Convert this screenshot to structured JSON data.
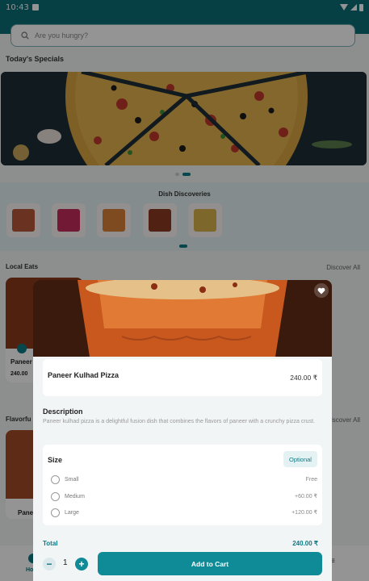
{
  "status": {
    "time": "10:43"
  },
  "search": {
    "placeholder": "Are you hungry?"
  },
  "sections": {
    "specials_title": "Today's Specials",
    "discoveries_title": "Dish Discoveries",
    "local_eats_title": "Local Eats",
    "local_eats_link": "Discover All",
    "flavorful_title": "Flavorfu",
    "flavorful_link": "Discover All"
  },
  "background_cards": {
    "card1_name": "Paneer",
    "card1_price": "240.00",
    "card2_name": "Pane"
  },
  "bottom_nav": {
    "home_label": "Ho"
  },
  "dish": {
    "name": "Paneer Kulhad Pizza",
    "price": "240.00 ₹",
    "description_title": "Description",
    "description": "Paneer kulhad pizza is a delightful fusion dish that combines the flavors of paneer with a crunchy pizza crust."
  },
  "size": {
    "title": "Size",
    "badge": "Optional",
    "options": [
      {
        "label": "Small",
        "price": "Free"
      },
      {
        "label": "Medium",
        "price": "+60.00 ₹"
      },
      {
        "label": "Large",
        "price": "+120.00 ₹"
      }
    ]
  },
  "total": {
    "label": "Total",
    "value": "240.00 ₹"
  },
  "cart": {
    "quantity": "1",
    "button_label": "Add to Cart"
  },
  "colors": {
    "accent": "#0b7a85",
    "header": "#0b6f78",
    "button": "#0e8b96"
  },
  "icons": [
    "search-icon",
    "heart-icon",
    "minus-icon",
    "plus-icon",
    "wifi-icon",
    "signal-icon",
    "battery-icon"
  ]
}
